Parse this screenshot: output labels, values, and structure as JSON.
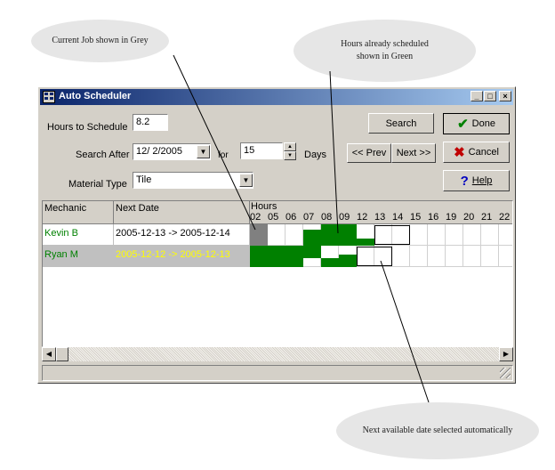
{
  "callouts": {
    "grey_job": "Current Job shown in Grey",
    "scheduled_line1": "Hours already scheduled",
    "scheduled_line2": "shown in Green",
    "next_available": "Next available date selected automatically"
  },
  "window": {
    "title": "Auto Scheduler",
    "controls": {
      "minimize": "_",
      "maximize": "□",
      "close": "×"
    }
  },
  "form": {
    "hours_label": "Hours to Schedule",
    "hours_value": "8.2",
    "search_after_label": "Search After",
    "search_after_value": "12/  2/2005",
    "for_label": "for",
    "days_value": "15",
    "days_label": "Days",
    "material_label": "Material Type",
    "material_value": "Tile"
  },
  "buttons": {
    "search": "Search",
    "done": "Done",
    "prev": "<< Prev",
    "next": "Next >>",
    "cancel": "Cancel",
    "help": "Help"
  },
  "icons": {
    "done": "check-icon",
    "cancel": "x-icon",
    "help": "question-icon",
    "done_color": "#008000",
    "cancel_color": "#c00000",
    "help_color": "#0000c0"
  },
  "grid": {
    "col_mechanic": "Mechanic",
    "col_next_date": "Next Date",
    "col_hours": "Hours",
    "hour_ticks": [
      "02",
      "05",
      "06",
      "07",
      "08",
      "09",
      "12",
      "13",
      "14",
      "15",
      "16",
      "19",
      "20",
      "21",
      "22"
    ],
    "rows": [
      {
        "mechanic": "Kevin B",
        "next_date": "2005-12-13 -> 2005-12-14",
        "mechanic_color": "#008000",
        "date_color": "#000000",
        "row_bg": "#ffffff"
      },
      {
        "mechanic": "Ryan M",
        "next_date": "2005-12-12 -> 2005-12-13",
        "mechanic_color": "#008000",
        "date_color": "#ffff00",
        "row_bg": "#c0c0c0"
      }
    ]
  },
  "colors": {
    "scheduled": "#008000",
    "current_job": "#808080",
    "title_start": "#0a246a"
  }
}
